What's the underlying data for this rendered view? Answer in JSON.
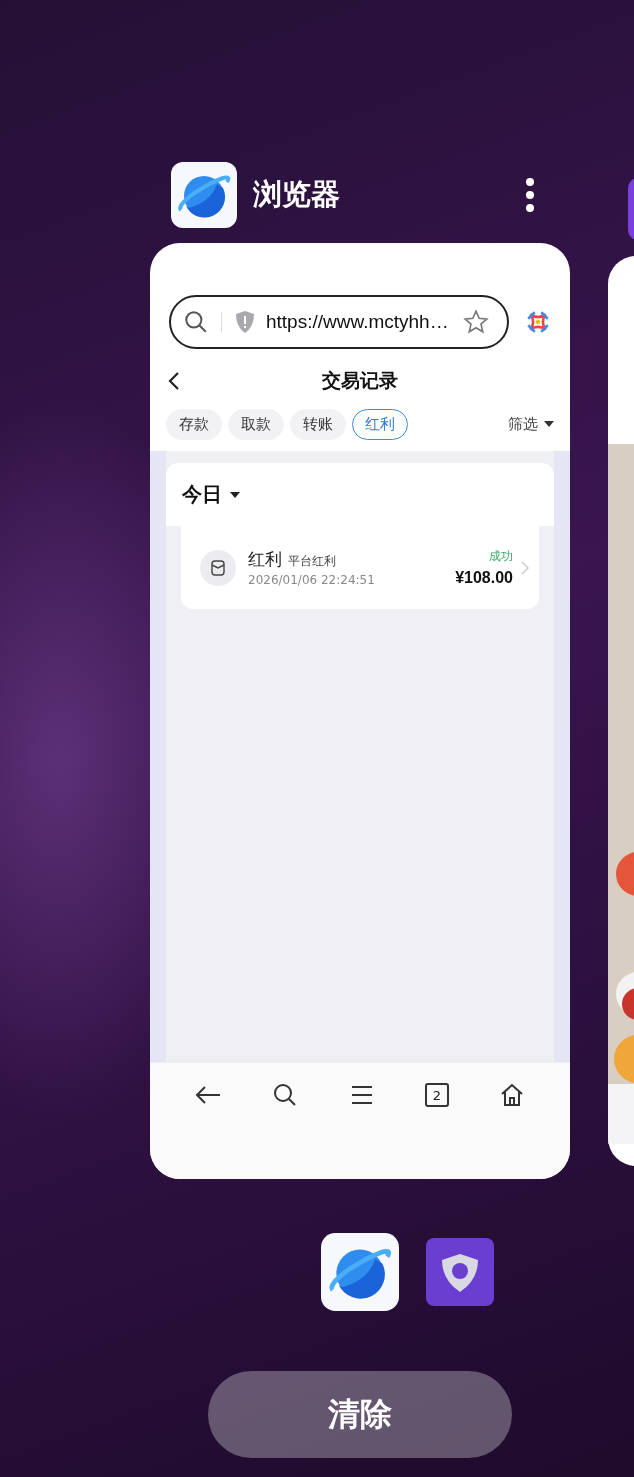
{
  "app": {
    "name": "浏览器"
  },
  "browser": {
    "url": "https://www.mctyhh…"
  },
  "page": {
    "title": "交易记录",
    "tabs": [
      {
        "label": "存款",
        "selected": false
      },
      {
        "label": "取款",
        "selected": false
      },
      {
        "label": "转账",
        "selected": false
      },
      {
        "label": "红利",
        "selected": true
      }
    ],
    "filter": "筛选",
    "group": {
      "label": "今日"
    },
    "records": [
      {
        "type": "红利",
        "subtitle": "平台红利",
        "time": "2026/01/06 22:24:51",
        "status": "成功",
        "amount": "¥108.00"
      }
    ]
  },
  "toolbar": {
    "tab_count": "2"
  },
  "clear_button": "清除"
}
